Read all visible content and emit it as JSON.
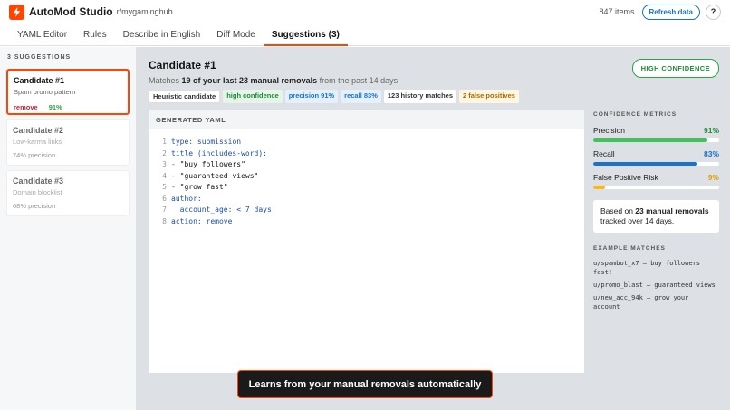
{
  "header": {
    "app_title": "AutoMod Studio",
    "subreddit": "r/mygaminghub",
    "items_count": "847 items",
    "refresh_label": "Refresh data",
    "help_label": "?"
  },
  "tabs": [
    {
      "label": "YAML Editor"
    },
    {
      "label": "Rules"
    },
    {
      "label": "Describe in English"
    },
    {
      "label": "Diff Mode"
    },
    {
      "label": "Suggestions (3)"
    }
  ],
  "sidebar": {
    "heading": "3 SUGGESTIONS",
    "candidates": [
      {
        "title": "Candidate #1",
        "desc": "Spam promo pattern",
        "action": "remove",
        "precision": "91%"
      },
      {
        "title": "Candidate #2",
        "desc": "Low-karma links",
        "precision_text": "74% precision"
      },
      {
        "title": "Candidate #3",
        "desc": "Domain blocklist",
        "precision_text": "68% precision"
      }
    ]
  },
  "candidate": {
    "title": "Candidate #1",
    "sub_pre": "Matches ",
    "sub_bold": "19 of your last 23 manual removals",
    "sub_post": " from the past 14 days",
    "confidence_badge": "HIGH CONFIDENCE",
    "chips": [
      "Heuristic candidate",
      "high confidence",
      "precision 91%",
      "recall 83%",
      "123 history matches",
      "2 false positives"
    ]
  },
  "yaml": {
    "heading": "GENERATED YAML",
    "lines": [
      {
        "num": "1",
        "key": "type:",
        "val": " submission"
      },
      {
        "num": "2",
        "key": "title (includes-word):",
        "val": ""
      },
      {
        "num": "3",
        "key": "- ",
        "val": "\"buy followers\""
      },
      {
        "num": "4",
        "key": "- ",
        "val": "\"guaranteed views\""
      },
      {
        "num": "5",
        "key": "- ",
        "val": "\"grow fast\""
      },
      {
        "num": "6",
        "key": "author:",
        "val": ""
      },
      {
        "num": "7",
        "key": "  account_age:",
        "val": " < 7 days"
      },
      {
        "num": "8",
        "key": "action:",
        "val": " remove"
      }
    ]
  },
  "metrics": {
    "heading": "CONFIDENCE METRICS",
    "items": [
      {
        "label": "Precision",
        "value": "91%",
        "fraction": 0.91,
        "color": "#3ec45a"
      },
      {
        "label": "Recall",
        "value": "83%",
        "fraction": 0.83,
        "color": "#1a73c9"
      },
      {
        "label": "False Positive Risk",
        "value": "9%",
        "fraction": 0.09,
        "color": "#f5b829"
      }
    ],
    "info_pre": "Based on ",
    "info_bold": "23 manual removals",
    "info_post": " tracked over 14 days.",
    "examples_heading": "EXAMPLE MATCHES",
    "examples": [
      "u/spambot_x7 — buy followers fast!",
      "u/promo_blast — guaranteed views",
      "u/new_acc_94k — grow your account"
    ]
  },
  "toast": "Learns from your manual removals automatically"
}
